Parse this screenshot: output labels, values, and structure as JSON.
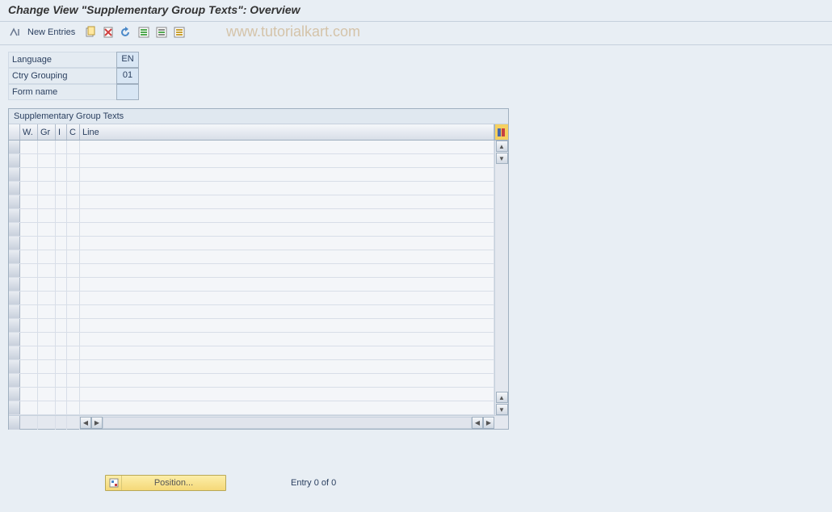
{
  "title": "Change View \"Supplementary Group Texts\": Overview",
  "toolbar": {
    "new_entries_label": "New Entries"
  },
  "watermark": "www.tutorialkart.com",
  "header": {
    "language_label": "Language",
    "language_value": "EN",
    "ctry_grouping_label": "Ctry Grouping",
    "ctry_grouping_value": "01",
    "form_name_label": "Form name",
    "form_name_value": ""
  },
  "table": {
    "title": "Supplementary Group Texts",
    "columns": {
      "w": "W.",
      "gr": "Gr",
      "i": "I",
      "c": "C",
      "line": "Line"
    }
  },
  "footer": {
    "position_label": "Position...",
    "entry_text": "Entry 0 of 0"
  }
}
